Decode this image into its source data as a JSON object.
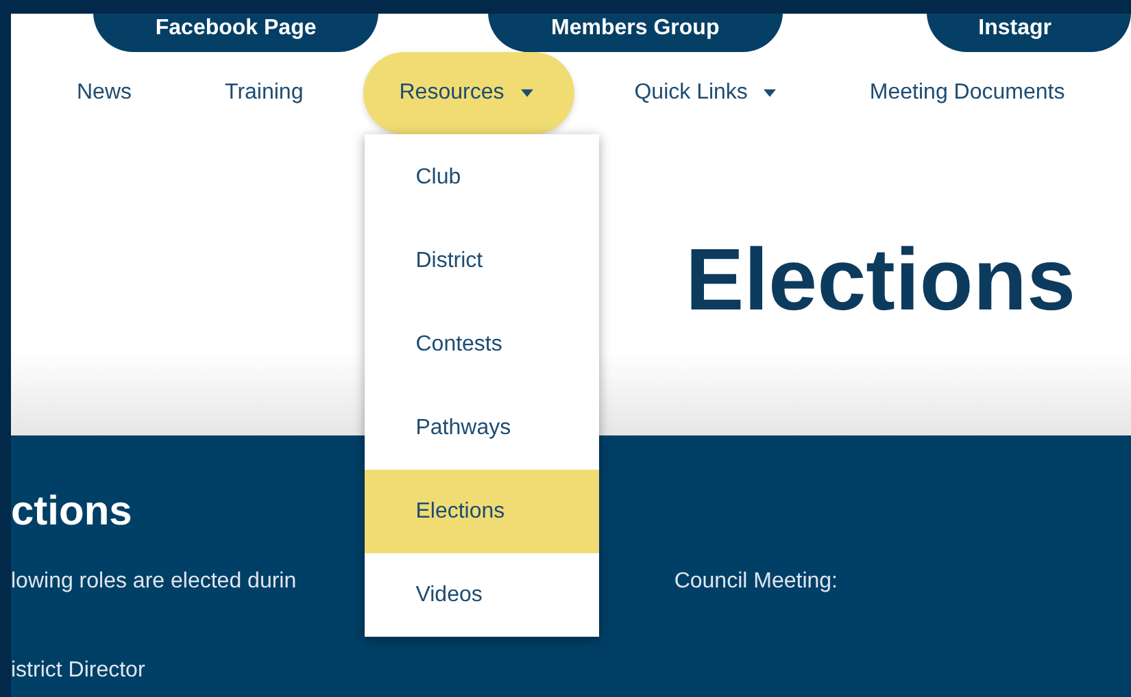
{
  "social_buttons": [
    {
      "label": "Facebook Page"
    },
    {
      "label": "Members Group"
    },
    {
      "label": "Instagr"
    }
  ],
  "nav": [
    {
      "label": "News",
      "dropdown": false,
      "selected": false
    },
    {
      "label": "Training",
      "dropdown": false,
      "selected": false
    },
    {
      "label": "Resources",
      "dropdown": true,
      "selected": true,
      "menu": [
        {
          "label": "Club",
          "selected": false
        },
        {
          "label": "District",
          "selected": false
        },
        {
          "label": "Contests",
          "selected": false
        },
        {
          "label": "Pathways",
          "selected": false
        },
        {
          "label": "Elections",
          "selected": true
        },
        {
          "label": "Videos",
          "selected": false
        }
      ]
    },
    {
      "label": "Quick Links",
      "dropdown": true,
      "selected": false
    },
    {
      "label": "Meeting Documents",
      "dropdown": false,
      "selected": false
    }
  ],
  "hero": {
    "title": "Elections"
  },
  "section": {
    "heading": "ctions",
    "intro_start": "lowing roles are elected durin",
    "intro_end": "Council Meeting:",
    "roles": [
      "istrict Director"
    ]
  }
}
